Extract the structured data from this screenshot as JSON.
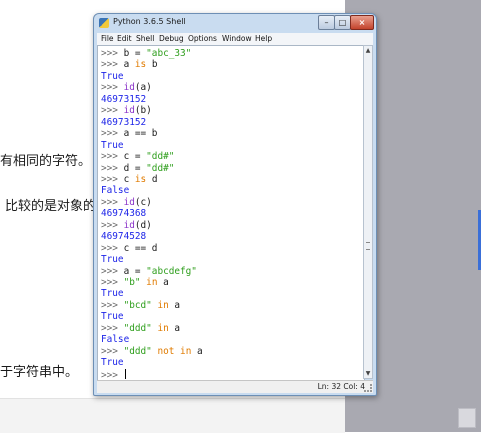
{
  "background_doc": {
    "fragments": [
      "有相同的字符。",
      "比较的是对象的",
      "于字符串中。"
    ]
  },
  "window": {
    "title": "Python 3.6.5 Shell",
    "controls": {
      "minimize": "–",
      "maximize": "□",
      "close": "×"
    },
    "menu": [
      "File",
      "Edit",
      "Shell",
      "Debug",
      "Options",
      "Window",
      "Help"
    ],
    "status": "Ln: 32  Col: 4"
  },
  "shell_lines": [
    [
      [
        "p",
        ">>> "
      ],
      [
        "c",
        "b = "
      ],
      [
        "s",
        "\"abc_33\""
      ]
    ],
    [
      [
        "p",
        ">>> "
      ],
      [
        "c",
        "a "
      ],
      [
        "k",
        "is"
      ],
      [
        "c",
        " b"
      ]
    ],
    [
      [
        "o",
        "True"
      ]
    ],
    [
      [
        "p",
        ">>> "
      ],
      [
        "b",
        "id"
      ],
      [
        "c",
        "(a)"
      ]
    ],
    [
      [
        "o",
        "46973152"
      ]
    ],
    [
      [
        "p",
        ">>> "
      ],
      [
        "b",
        "id"
      ],
      [
        "c",
        "(b)"
      ]
    ],
    [
      [
        "o",
        "46973152"
      ]
    ],
    [
      [
        "p",
        ">>> "
      ],
      [
        "c",
        "a == b"
      ]
    ],
    [
      [
        "o",
        "True"
      ]
    ],
    [
      [
        "p",
        ">>> "
      ],
      [
        "c",
        "c = "
      ],
      [
        "s",
        "\"dd#\""
      ]
    ],
    [
      [
        "p",
        ">>> "
      ],
      [
        "c",
        "d = "
      ],
      [
        "s",
        "\"dd#\""
      ]
    ],
    [
      [
        "p",
        ">>> "
      ],
      [
        "c",
        "c "
      ],
      [
        "k",
        "is"
      ],
      [
        "c",
        " d"
      ]
    ],
    [
      [
        "o",
        "False"
      ]
    ],
    [
      [
        "p",
        ">>> "
      ],
      [
        "b",
        "id"
      ],
      [
        "c",
        "(c)"
      ]
    ],
    [
      [
        "o",
        "46974368"
      ]
    ],
    [
      [
        "p",
        ">>> "
      ],
      [
        "b",
        "id"
      ],
      [
        "c",
        "(d)"
      ]
    ],
    [
      [
        "o",
        "46974528"
      ]
    ],
    [
      [
        "p",
        ">>> "
      ],
      [
        "c",
        "c == d"
      ]
    ],
    [
      [
        "o",
        "True"
      ]
    ],
    [
      [
        "p",
        ">>> "
      ],
      [
        "c",
        "a = "
      ],
      [
        "s",
        "\"abcdefg\""
      ]
    ],
    [
      [
        "p",
        ">>> "
      ],
      [
        "s",
        "\"b\""
      ],
      [
        "c",
        " "
      ],
      [
        "k",
        "in"
      ],
      [
        "c",
        " a"
      ]
    ],
    [
      [
        "o",
        "True"
      ]
    ],
    [
      [
        "p",
        ">>> "
      ],
      [
        "s",
        "\"bcd\""
      ],
      [
        "c",
        " "
      ],
      [
        "k",
        "in"
      ],
      [
        "c",
        " a"
      ]
    ],
    [
      [
        "o",
        "True"
      ]
    ],
    [
      [
        "p",
        ">>> "
      ],
      [
        "s",
        "\"ddd\""
      ],
      [
        "c",
        " "
      ],
      [
        "k",
        "in"
      ],
      [
        "c",
        " a"
      ]
    ],
    [
      [
        "o",
        "False"
      ]
    ],
    [
      [
        "p",
        ">>> "
      ],
      [
        "s",
        "\"ddd\""
      ],
      [
        "c",
        " "
      ],
      [
        "k",
        "not in"
      ],
      [
        "c",
        " a"
      ]
    ],
    [
      [
        "o",
        "True"
      ]
    ],
    [
      [
        "p",
        ">>> "
      ]
    ]
  ]
}
